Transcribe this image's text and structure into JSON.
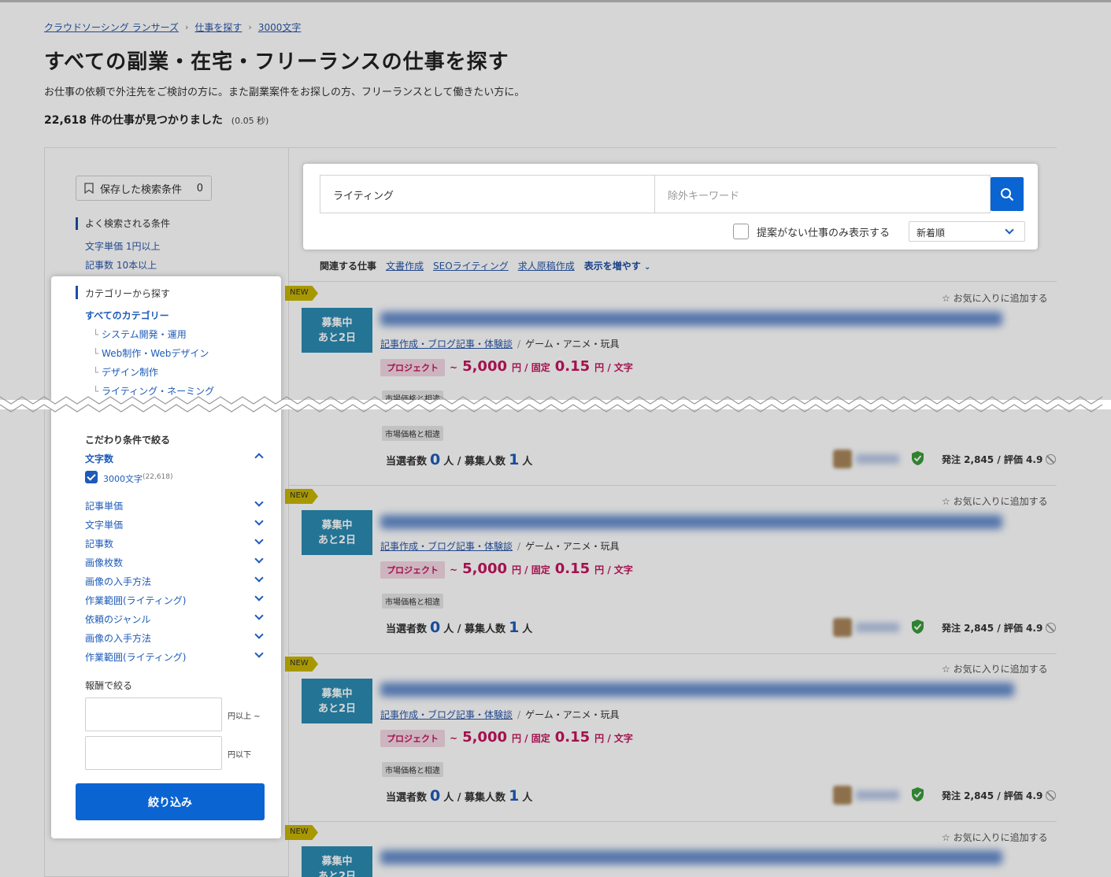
{
  "breadcrumb": [
    "クラウドソーシング ランサーズ",
    "仕事を探す",
    "3000文字"
  ],
  "breadcrumb_sep": "›",
  "title": "すべての副業・在宅・フリーランスの仕事を探す",
  "description": "お仕事の依頼で外注先をご検討の方に。また副業案件をお探しの方、フリーランスとして働きたい方に。",
  "results": {
    "count": "22,618",
    "suffix": "件の仕事が見つかりました",
    "time": "(0.05 秒)"
  },
  "sidebar": {
    "saved_search_label": "保存した検索条件",
    "saved_search_count": "0",
    "frequent_head": "よく検索される条件",
    "frequent_links": [
      "文字単価 1円以上",
      "記事数 10本以上"
    ]
  },
  "filter_panel": {
    "category_head": "カテゴリーから探す",
    "all_categories": "すべてのカテゴリー",
    "categories": [
      "システム開発・運用",
      "Web制作・Webデザイン",
      "デザイン制作",
      "ライティング・ネーミング"
    ],
    "narrow_head": "こだわり条件で絞る",
    "open_filter": "文字数",
    "checked_option": "3000文字",
    "checked_option_count": "(22,618)",
    "filters": [
      "記事単価",
      "文字単価",
      "記事数",
      "画像枚数",
      "画像の入手方法",
      "作業範囲(ライティング)",
      "依頼のジャンル",
      "画像の入手方法",
      "作業範囲(ライティング)"
    ],
    "reward_head": "報酬で絞る",
    "reward_min_suffix": "円以上 ~",
    "reward_max_suffix": "円以下",
    "submit_label": "絞り込み"
  },
  "search": {
    "keyword_value": "ライティング",
    "exclude_placeholder": "除外キーワード",
    "no_proposal_label": "提案がない仕事のみ表示する",
    "sort_value": "新着順"
  },
  "related": {
    "label": "関連する仕事",
    "links": [
      "文書作成",
      "SEOライティング",
      "求人原稿作成"
    ],
    "more": "表示を増やす"
  },
  "job_common": {
    "new_label": "NEW",
    "status": "募集中",
    "days_left": "あと2日",
    "favorite": "☆ お気に入りに追加する",
    "category_link": "記事作成・ブログ記事・体験談",
    "category_sub": "ゲーム・アニメ・玩具",
    "project_tag": "プロジェクト",
    "price_prefix": "~",
    "price_main": "5,000",
    "price_unit1": "円 / 固定",
    "price_rate": "0.15",
    "price_unit2": "円 / 文字",
    "market_tag": "市場価格と相違",
    "selected_label": "当選者数",
    "selected_count": "0",
    "recruit_label": "人 / 募集人数",
    "recruit_count": "1",
    "person_unit": "人",
    "client_stats": "発注 2,845 / 評価 4.9"
  },
  "colors": {
    "accent": "#0a64d2",
    "price": "#c4155e",
    "status": "#2a8bb2",
    "new": "#c9b500"
  }
}
